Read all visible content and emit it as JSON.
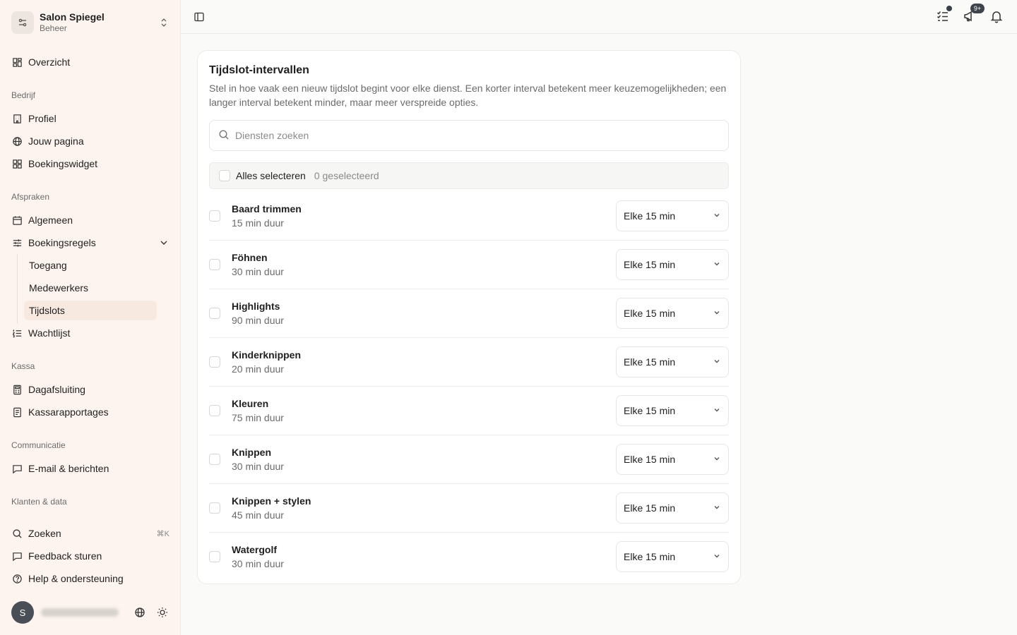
{
  "org": {
    "name": "Salon Spiegel",
    "role": "Beheer"
  },
  "nav": {
    "overview": "Overzicht",
    "sections": {
      "bedrijf": "Bedrijf",
      "afspraken": "Afspraken",
      "kassa": "Kassa",
      "communicatie": "Communicatie",
      "klanten": "Klanten & data"
    },
    "profiel": "Profiel",
    "jouw_pagina": "Jouw pagina",
    "boekingswidget": "Boekingswidget",
    "algemeen": "Algemeen",
    "boekingsregels": "Boekingsregels",
    "sub": {
      "toegang": "Toegang",
      "medewerkers": "Medewerkers",
      "tijdslots": "Tijdslots"
    },
    "wachtlijst": "Wachtlijst",
    "dagafsluiting": "Dagafsluiting",
    "kassarapportages": "Kassarapportages",
    "email": "E-mail & berichten",
    "zoeken": "Zoeken",
    "zoeken_shortcut": "⌘K",
    "feedback": "Feedback sturen",
    "help": "Help & ondersteuning"
  },
  "user": {
    "initial": "S"
  },
  "topbar": {
    "notif_badge": "9+"
  },
  "card": {
    "title": "Tijdslot-intervallen",
    "description": "Stel in hoe vaak een nieuw tijdslot begint voor elke dienst. Een korter interval betekent meer keuzemogelijkheden; een langer interval betekent minder, maar meer verspreide opties.",
    "search_placeholder": "Diensten zoeken",
    "select_all": "Alles selecteren",
    "selected_count": "0 geselecteerd",
    "services": [
      {
        "name": "Baard trimmen",
        "duration": "15 min duur",
        "interval": "Elke 15 min"
      },
      {
        "name": "Föhnen",
        "duration": "30 min duur",
        "interval": "Elke 15 min"
      },
      {
        "name": "Highlights",
        "duration": "90 min duur",
        "interval": "Elke 15 min"
      },
      {
        "name": "Kinderknippen",
        "duration": "20 min duur",
        "interval": "Elke 15 min"
      },
      {
        "name": "Kleuren",
        "duration": "75 min duur",
        "interval": "Elke 15 min"
      },
      {
        "name": "Knippen",
        "duration": "30 min duur",
        "interval": "Elke 15 min"
      },
      {
        "name": "Knippen + stylen",
        "duration": "45 min duur",
        "interval": "Elke 15 min"
      },
      {
        "name": "Watergolf",
        "duration": "30 min duur",
        "interval": "Elke 15 min"
      }
    ]
  },
  "colors": {
    "sidebar_bg": "#fdf4ef",
    "active_item_bg": "#f8e9e0",
    "text": "#1f1f1f",
    "muted": "#6b6b6b"
  }
}
